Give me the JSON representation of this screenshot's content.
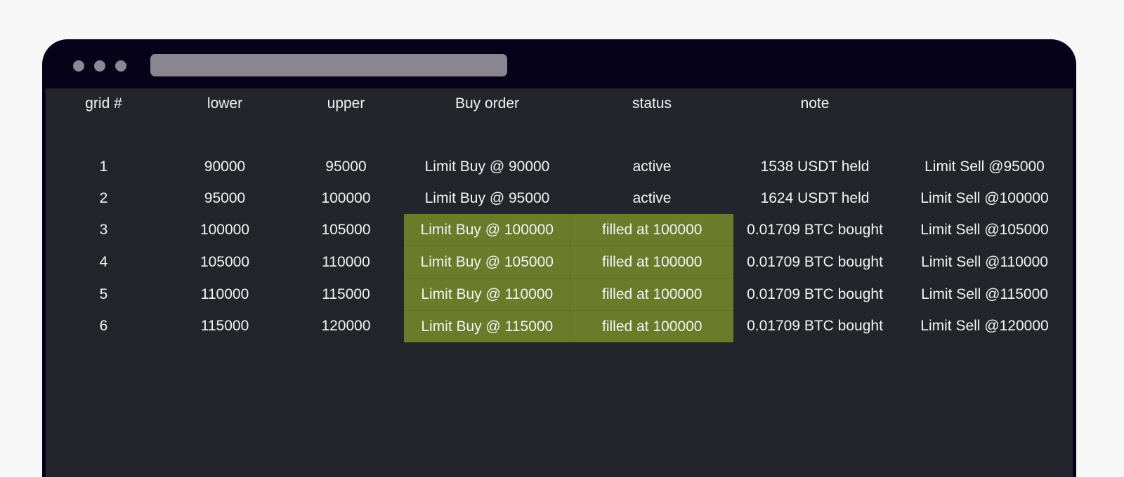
{
  "window": {
    "controls": [
      "close",
      "minimize",
      "maximize"
    ]
  },
  "table": {
    "headers": [
      "grid #",
      "lower",
      "upper",
      "Buy order",
      "status",
      "note",
      ""
    ],
    "rows": [
      {
        "grid": "1",
        "lower": "90000",
        "upper": "95000",
        "buy_order": "Limit Buy @ 90000",
        "status": "active",
        "note": "1538 USDT held",
        "sell_order": "Limit Sell @95000",
        "highlight": false
      },
      {
        "grid": "2",
        "lower": "95000",
        "upper": "100000",
        "buy_order": "Limit Buy @ 95000",
        "status": "active",
        "note": "1624 USDT held",
        "sell_order": "Limit Sell @100000",
        "highlight": false
      },
      {
        "grid": "3",
        "lower": "100000",
        "upper": "105000",
        "buy_order": "Limit Buy @ 100000",
        "status": "filled at 100000",
        "note": "0.01709 BTC bought",
        "sell_order": "Limit Sell @105000",
        "highlight": true
      },
      {
        "grid": "4",
        "lower": "105000",
        "upper": "110000",
        "buy_order": "Limit Buy @ 105000",
        "status": "filled at 100000",
        "note": "0.01709 BTC bought",
        "sell_order": "Limit Sell @110000",
        "highlight": true
      },
      {
        "grid": "5",
        "lower": "110000",
        "upper": "115000",
        "buy_order": "Limit Buy @ 110000",
        "status": "filled at 100000",
        "note": "0.01709 BTC bought",
        "sell_order": "Limit Sell @115000",
        "highlight": true
      },
      {
        "grid": "6",
        "lower": "115000",
        "upper": "120000",
        "buy_order": "Limit Buy @ 115000",
        "status": "filled at 100000",
        "note": "0.01709 BTC bought",
        "sell_order": "Limit Sell @120000",
        "highlight": true
      }
    ]
  },
  "colors": {
    "page_background": "#f7f7f7",
    "window_chrome": "#05021a",
    "content_background": "#23252b",
    "highlight_fill": "#6a7b2a",
    "text": "#f4f4f4"
  }
}
